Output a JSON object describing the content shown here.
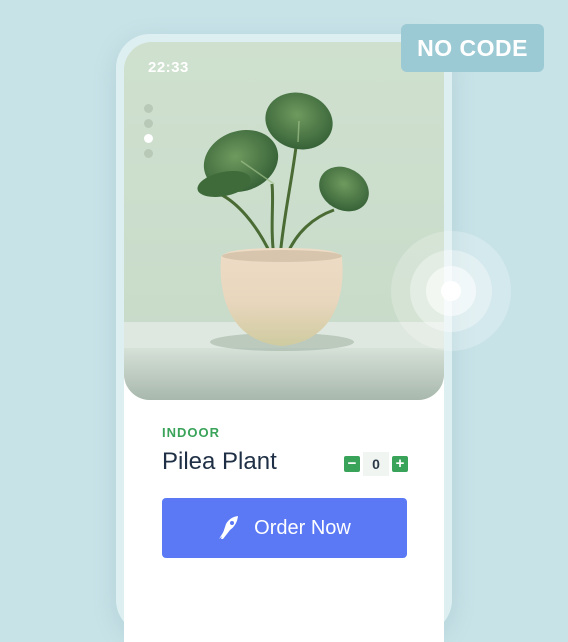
{
  "badge": {
    "label": "NO CODE"
  },
  "status_bar": {
    "time": "22:33"
  },
  "carousel": {
    "total": 4,
    "active_index": 2
  },
  "product": {
    "category": "INDOOR",
    "name": "Pilea Plant",
    "quantity": "0"
  },
  "stepper": {
    "minus": "−",
    "plus": "+"
  },
  "order_button": {
    "label": "Order Now",
    "icon": "rocket-icon"
  },
  "colors": {
    "accent_green": "#3aa35a",
    "button_blue": "#5b79f5",
    "title_text": "#1f2f45",
    "background": "#c8e3e8"
  }
}
